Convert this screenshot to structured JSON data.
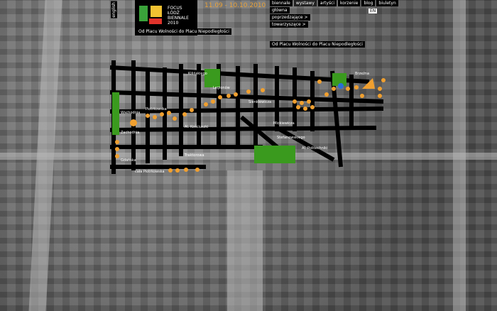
{
  "logo": {
    "lines": [
      "FOCUS",
      "ŁÓDŹ",
      "BIENNALE",
      "2010"
    ]
  },
  "language": "english",
  "dates": "11.09 - 10.10.2010",
  "nav": {
    "items": [
      "biennale",
      "wystawy",
      "artyści",
      "korzenie",
      "blog",
      "biuletyn"
    ],
    "active": "wystawy",
    "sub": [
      "główna",
      "poprzedzające >",
      "towarzyszące >"
    ]
  },
  "mark": "EN",
  "subtitle": "Od Placu Wolności do Placu Niepodległości",
  "map": {
    "highlight_color": "#3a9a1e",
    "marker_color": "#f0a030",
    "street_labels": [
      "Kilińskiego",
      "Wschodnia",
      "Zachodnia",
      "Gdańska",
      "Piotrkowska",
      "Al. Kościuszki",
      "Stefanowskiego",
      "Al. Politechniki",
      "Sienkiewicza",
      "Legionów",
      "Mickiewicza",
      "Brzeźna",
      "Traktorowa",
      "cała Piotrkowska"
    ]
  }
}
